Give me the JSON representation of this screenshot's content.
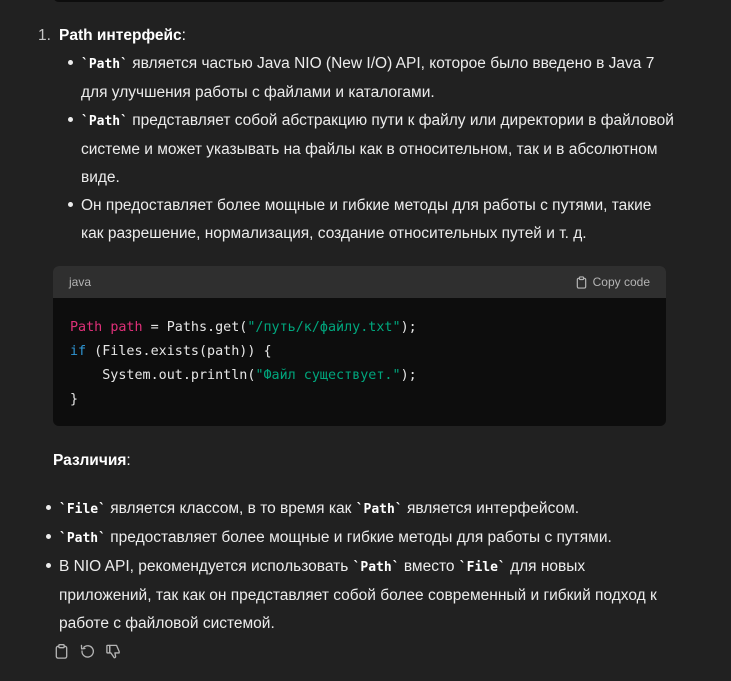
{
  "list": {
    "number": "1.",
    "title": "Path интерфейс",
    "title_colon": ":",
    "bullets": [
      {
        "code": "`Path`",
        "text": " является частью Java NIO (New I/O) API, которое было введено в Java 7 для улучшения работы с файлами и каталогами."
      },
      {
        "code": "`Path`",
        "text": " представляет собой абстракцию пути к файлу или директории в файловой системе и может указывать на файлы как в относительном, так и в абсолютном виде."
      },
      {
        "code": "",
        "text": "Он предоставляет более мощные и гибкие методы для работы с путями, такие как разрешение, нормализация, создание относительных путей и т. д."
      }
    ]
  },
  "code_block": {
    "language": "java",
    "copy_label": "Copy code",
    "lines": {
      "l1_type": "Path",
      "l1_var": "path",
      "l1_mid": " = Paths.get(",
      "l1_str": "\"/путь/к/файлу.txt\"",
      "l1_end": ");",
      "l2_kw": "if",
      "l2_rest": " (Files.exists(path)) {",
      "l3_pre": "    System.out.println(",
      "l3_str": "\"Файл существует.\"",
      "l3_end": ");",
      "l4": "}"
    }
  },
  "differences": {
    "title": "Различия",
    "title_colon": ":",
    "bullets": [
      {
        "c1": "`File`",
        "t1": " является классом, в то время как ",
        "c2": "`Path`",
        "t2": " является интерфейсом.",
        "c3": "",
        "t3": ""
      },
      {
        "c1": "`Path`",
        "t1": " предоставляет более мощные и гибкие методы для работы с путями.",
        "c2": "",
        "t2": "",
        "c3": "",
        "t3": ""
      },
      {
        "c1": "",
        "t1": "В NIO API, рекомендуется использовать ",
        "c2": "`Path`",
        "t2": " вместо ",
        "c3": "`File`",
        "t3": " для новых приложений, так как он представляет собой более современный и гибкий подход к работе с файловой системой."
      }
    ]
  },
  "actions": {
    "icons": [
      "clipboard-icon",
      "regenerate-icon",
      "thumbs-down-icon"
    ]
  },
  "colors": {
    "background": "#212121",
    "code_bg": "#0d0d0d",
    "code_header_bg": "#2f2f2f",
    "keyword_pink": "#df3079",
    "keyword_blue": "#2e95d3",
    "string_green": "#00a67d"
  }
}
